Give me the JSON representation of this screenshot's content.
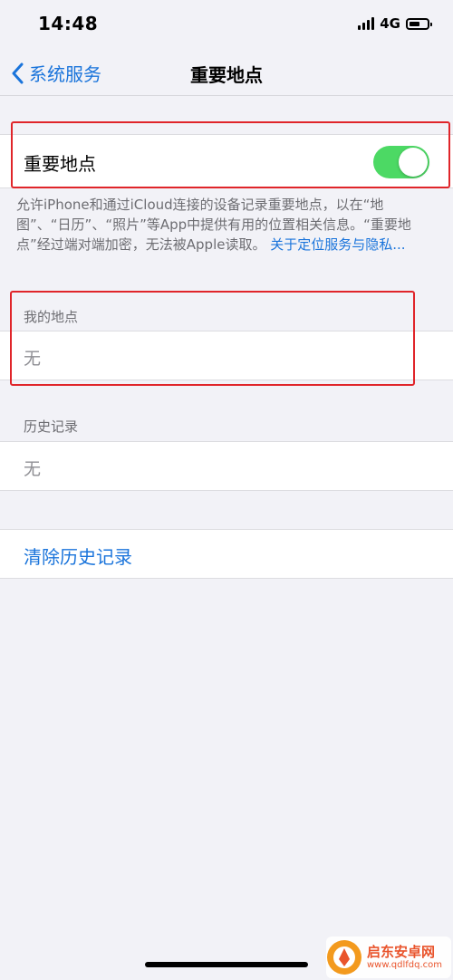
{
  "status_bar": {
    "time": "14:48",
    "network": "4G",
    "signal_icon": "signal-bars-icon",
    "battery_icon": "battery-icon"
  },
  "nav": {
    "back_label": "系统服务",
    "back_icon": "chevron-left-icon",
    "title": "重要地点"
  },
  "significant_locations": {
    "label": "重要地点",
    "enabled": true,
    "toggle_on_color": "#4cd964",
    "description": "允许iPhone和通过iCloud连接的设备记录重要地点，以在“地图”、“日历”、“照片”等App中提供有用的位置相关信息。“重要地点”经过端对端加密，无法被Apple读取。",
    "link_text": "关于定位服务与隐私..."
  },
  "my_places": {
    "header": "我的地点",
    "empty_text": "无"
  },
  "history": {
    "header": "历史记录",
    "empty_text": "无"
  },
  "actions": {
    "clear_history": "清除历史记录"
  },
  "theme": {
    "accent": "#1a74db",
    "background": "#f2f2f7",
    "highlight": "#e0252a"
  },
  "watermark": {
    "title": "启东安卓网",
    "url": "www.qdlfdq.com",
    "logo_icon": "brand-logo-icon"
  }
}
